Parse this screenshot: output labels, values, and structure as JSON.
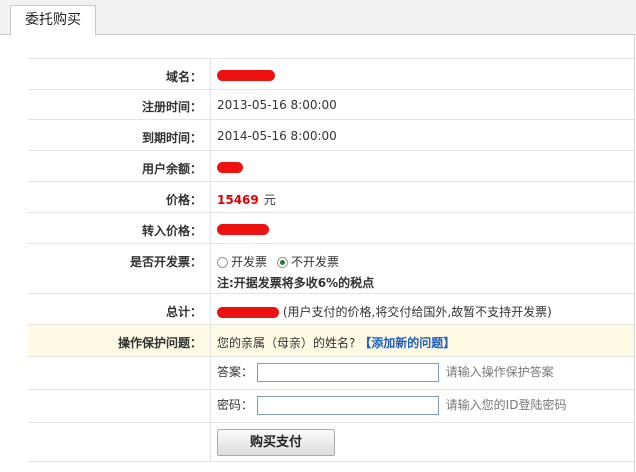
{
  "tab": {
    "label": "委托购买"
  },
  "rows": {
    "domain": {
      "label": "域名："
    },
    "reg_time": {
      "label": "注册时间：",
      "value": "2013-05-16 8:00:00"
    },
    "exp_time": {
      "label": "到期时间：",
      "value": "2014-05-16 8:00:00"
    },
    "balance": {
      "label": "用户余额："
    },
    "price": {
      "label": "价格：",
      "value": "15469",
      "unit": "元"
    },
    "transfer_price": {
      "label": "转入价格："
    },
    "invoice": {
      "label": "是否开发票：",
      "option_yes": "开发票",
      "option_no": "不开发票",
      "selected": "不开发票",
      "note": "注:开据发票将多收6%的税点"
    },
    "total": {
      "label": "总计：",
      "note": "(用户支付的价格,将交付给国外,故暂不支持开发票)"
    },
    "security": {
      "label": "操作保护问题：",
      "question_prefix": "您的亲属（",
      "question_relation": "母亲",
      "question_suffix": "）的姓名?",
      "add_link": "【添加新的问题】"
    },
    "answer": {
      "label": "答案：",
      "value": "",
      "hint": "请输入操作保护答案"
    },
    "password": {
      "label": "密码：",
      "value": "",
      "hint": "请输入您的ID登陆密码"
    }
  },
  "submit": {
    "label": "购买支付"
  },
  "colors": {
    "accent_red": "#e00000",
    "link_blue": "#1f5fbf",
    "highlight_row": "#fdf9e3"
  }
}
